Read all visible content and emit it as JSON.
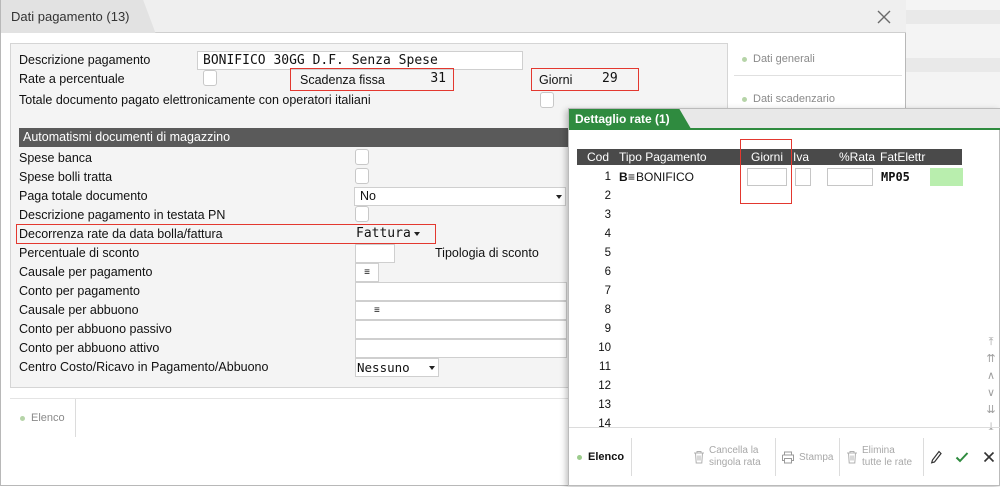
{
  "main": {
    "tab_title": "Dati pagamento (13)",
    "fields": {
      "descrizione_label": "Descrizione pagamento",
      "descrizione_value": "BONIFICO 30GG D.F. Senza Spese",
      "rate_label": "Rate a percentuale",
      "scadenza_label": "Scadenza fissa",
      "scadenza_value": "31",
      "giorni_label": "Giorni",
      "giorni_value": "29",
      "totale_label": "Totale documento pagato elettronicamente con operatori italiani"
    },
    "section_title": "Automatismi documenti di magazzino",
    "automatismi": {
      "spese_banca": "Spese banca",
      "spese_bolli": "Spese bolli tratta",
      "paga_totale_label": "Paga totale documento",
      "paga_totale_value": "No",
      "desc_testata_label": "Descrizione pagamento in testata PN",
      "decorrenza_label": "Decorrenza rate da data bolla/fattura",
      "decorrenza_value": "Fattura",
      "percentuale_label": "Percentuale di sconto",
      "tipologia_label": "Tipologia di sconto",
      "causale_pagamento": "Causale per pagamento",
      "conto_pagamento": "Conto per pagamento",
      "causale_abbuono": "Causale per abbuono",
      "conto_abbuono_passivo": "Conto per abbuono passivo",
      "conto_abbuono_attivo": "Conto per abbuono attivo",
      "centro_costo_label": "Centro Costo/Ricavo in Pagamento/Abbuono",
      "centro_costo_value": "Nessuno"
    },
    "side_nav": [
      "Dati generali",
      "Dati scadenzario"
    ],
    "footer_elenco": "Elenco"
  },
  "dialog": {
    "title": "Dettaglio rate (1)",
    "columns": {
      "cod": "Cod",
      "tipo": "Tipo Pagamento",
      "giorni": "Giorni",
      "iva": "Iva",
      "rata": "%Rata",
      "fat": "FatElettr"
    },
    "row1": {
      "cod": "1",
      "tipo_code": "B",
      "tipo_name": "BONIFICO",
      "fat": "MP05"
    },
    "row_codes": [
      "2",
      "3",
      "4",
      "5",
      "6",
      "7",
      "8",
      "9",
      "10",
      "11",
      "12",
      "13",
      "14"
    ],
    "footer": {
      "elenco": "Elenco",
      "cancella_line1": "Cancella la",
      "cancella_line2": "singola rata",
      "stampa": "Stampa",
      "elimina_line1": "Elimina",
      "elimina_line2": "tutte le rate"
    },
    "scroll_icons": [
      "first-page-icon",
      "page-up-icon",
      "line-up-icon",
      "line-down-icon",
      "page-down-icon",
      "last-page-icon"
    ]
  },
  "colors": {
    "accent_green": "#2f8b3f",
    "highlight_red": "#e3382f",
    "section_bar": "#5a5a5a",
    "grid_header": "#4a4a4a",
    "fat_cell": "#b9eeae"
  }
}
